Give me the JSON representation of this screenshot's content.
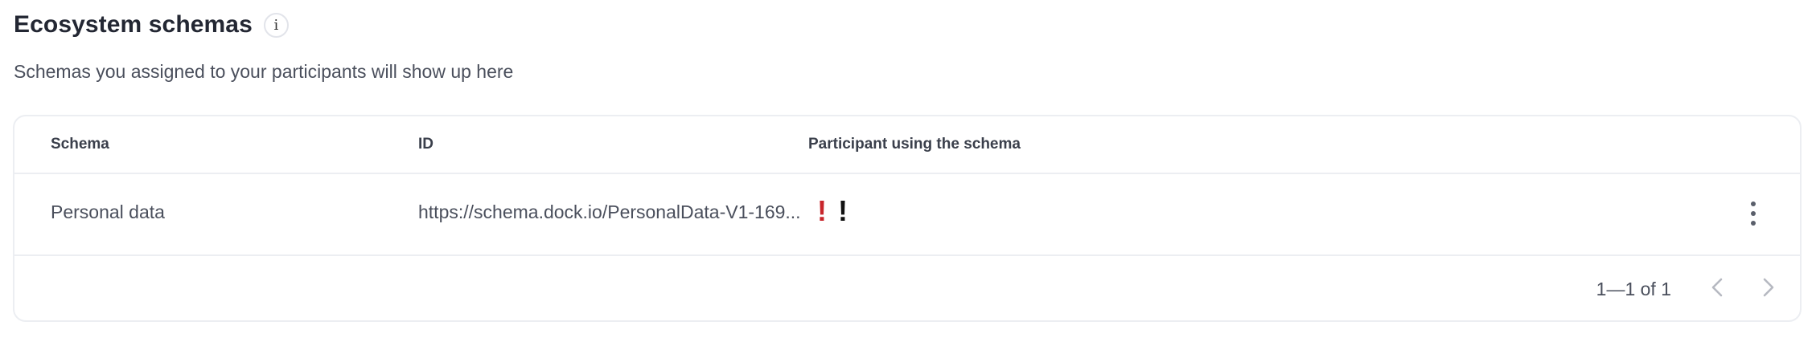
{
  "section": {
    "title": "Ecosystem schemas",
    "info_icon_glyph": "i",
    "subtitle": "Schemas you assigned to your participants will show up here"
  },
  "table": {
    "columns": [
      "Schema",
      "ID",
      "Participant using the schema"
    ],
    "rows": [
      {
        "schema": "Personal data",
        "id": "https://schema.dock.io/PersonalData-V1-169...",
        "participants": [
          {
            "icon": "!",
            "color": "#c8262c",
            "icon_name": "red-exclamation-icon"
          },
          {
            "icon": "!",
            "color": "#111111",
            "icon_name": "black-exclamation-icon"
          }
        ]
      }
    ]
  },
  "pagination": {
    "range_text": "1—1 of 1",
    "prev_icon": "chevron-left-icon",
    "next_icon": "chevron-right-icon"
  },
  "colors": {
    "border": "#eceef2",
    "text_primary": "#232733",
    "text_secondary": "#4a4f5c",
    "alert_red": "#c8262c"
  }
}
